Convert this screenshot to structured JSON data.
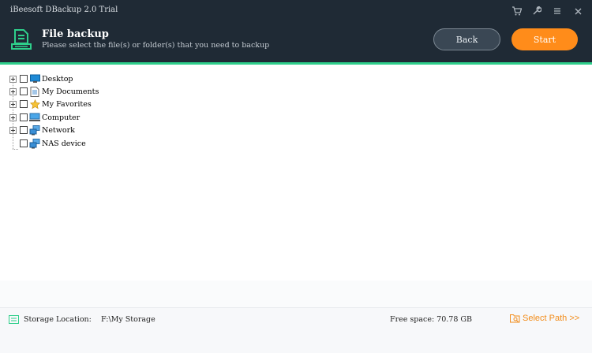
{
  "app": {
    "title": "iBeesoft DBackup 2.0 Trial"
  },
  "window_controls": [
    {
      "icon": "cart-icon"
    },
    {
      "icon": "wrench-icon"
    },
    {
      "icon": "menu-icon"
    },
    {
      "icon": "close-icon"
    }
  ],
  "page": {
    "title": "File backup",
    "subtitle": "Please select the file(s) or folder(s) that you need to backup",
    "icon": "file-backup-icon"
  },
  "buttons": {
    "back": "Back",
    "start": "Start"
  },
  "colors": {
    "header_bg": "#1f2a35",
    "accent_green": "#2ecf8b",
    "start_orange": "#ff8c1a",
    "link_orange": "#f28c1a"
  },
  "tree": {
    "items": [
      {
        "label": "Desktop",
        "icon": "desktop-icon",
        "expandable": true,
        "checked": false
      },
      {
        "label": "My Documents",
        "icon": "documents-icon",
        "expandable": true,
        "checked": false
      },
      {
        "label": "My Favorites",
        "icon": "star-icon",
        "expandable": true,
        "checked": false
      },
      {
        "label": "Computer",
        "icon": "computer-icon",
        "expandable": true,
        "checked": false
      },
      {
        "label": "Network",
        "icon": "network-icon",
        "expandable": true,
        "checked": false
      },
      {
        "label": "NAS device",
        "icon": "nas-icon",
        "expandable": false,
        "checked": false
      }
    ]
  },
  "footer": {
    "storage_label": "Storage Location:",
    "storage_value": "F:\\My Storage",
    "free_space": "Free space: 70.78 GB",
    "select_path": "Select Path >>"
  }
}
